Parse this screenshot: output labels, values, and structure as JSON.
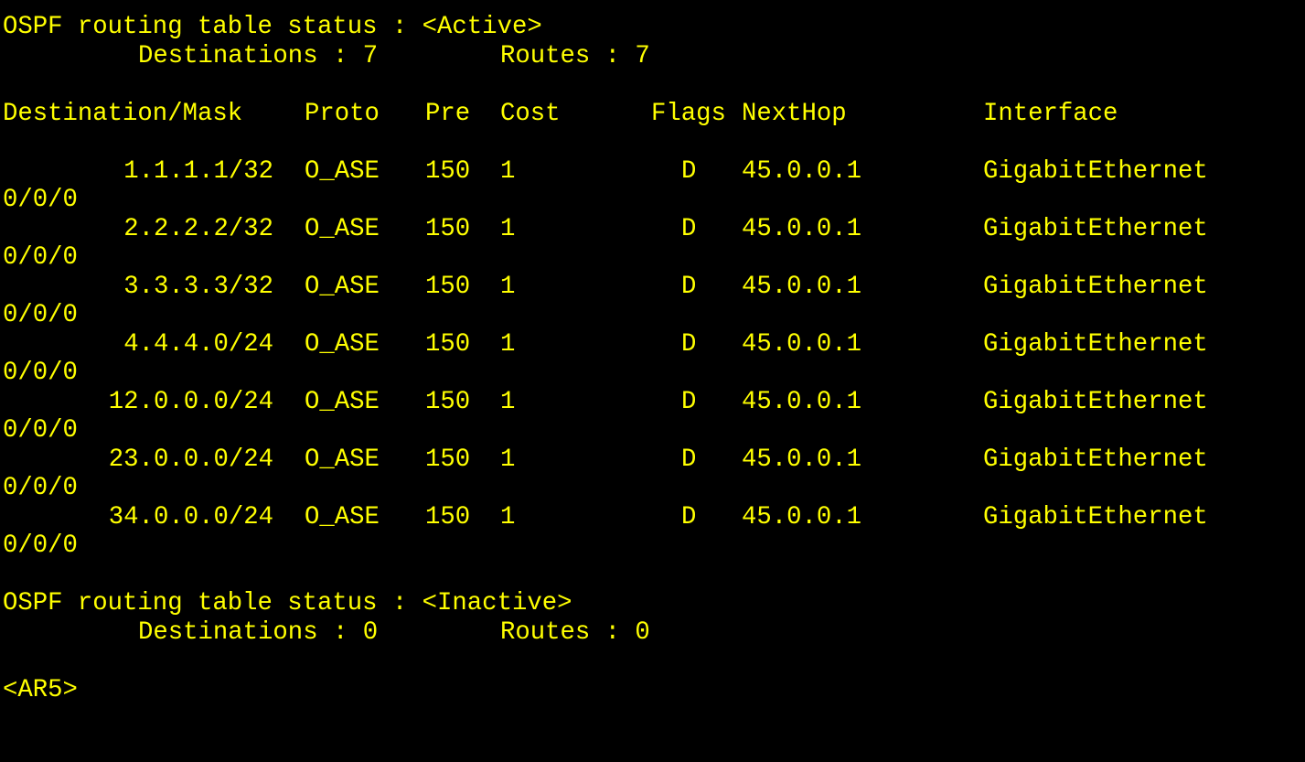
{
  "colors": {
    "background": "#000000",
    "foreground": "#ffff00"
  },
  "active_section": {
    "status_line": "OSPF routing table status : <Active>",
    "destinations_text": "Destinations : 7",
    "routes_text": "Routes : 7"
  },
  "table": {
    "headers": {
      "destination_mask": "Destination/Mask",
      "proto": "Proto",
      "pre": "Pre",
      "cost": "Cost",
      "flags": "Flags",
      "nexthop": "NextHop",
      "interface": "Interface"
    },
    "rows": [
      {
        "destination": "1.1.1.1/32",
        "proto": "O_ASE",
        "pre": "150",
        "cost": "1",
        "flags": "D",
        "nexthop": "45.0.0.1",
        "interface": "GigabitEthernet",
        "interface_cont": "0/0/0"
      },
      {
        "destination": "2.2.2.2/32",
        "proto": "O_ASE",
        "pre": "150",
        "cost": "1",
        "flags": "D",
        "nexthop": "45.0.0.1",
        "interface": "GigabitEthernet",
        "interface_cont": "0/0/0"
      },
      {
        "destination": "3.3.3.3/32",
        "proto": "O_ASE",
        "pre": "150",
        "cost": "1",
        "flags": "D",
        "nexthop": "45.0.0.1",
        "interface": "GigabitEthernet",
        "interface_cont": "0/0/0"
      },
      {
        "destination": "4.4.4.0/24",
        "proto": "O_ASE",
        "pre": "150",
        "cost": "1",
        "flags": "D",
        "nexthop": "45.0.0.1",
        "interface": "GigabitEthernet",
        "interface_cont": "0/0/0"
      },
      {
        "destination": "12.0.0.0/24",
        "proto": "O_ASE",
        "pre": "150",
        "cost": "1",
        "flags": "D",
        "nexthop": "45.0.0.1",
        "interface": "GigabitEthernet",
        "interface_cont": "0/0/0"
      },
      {
        "destination": "23.0.0.0/24",
        "proto": "O_ASE",
        "pre": "150",
        "cost": "1",
        "flags": "D",
        "nexthop": "45.0.0.1",
        "interface": "GigabitEthernet",
        "interface_cont": "0/0/0"
      },
      {
        "destination": "34.0.0.0/24",
        "proto": "O_ASE",
        "pre": "150",
        "cost": "1",
        "flags": "D",
        "nexthop": "45.0.0.1",
        "interface": "GigabitEthernet",
        "interface_cont": "0/0/0"
      }
    ]
  },
  "inactive_section": {
    "status_line": "OSPF routing table status : <Inactive>",
    "destinations_text": "Destinations : 0",
    "routes_text": "Routes : 0"
  },
  "prompt": "<AR5>"
}
